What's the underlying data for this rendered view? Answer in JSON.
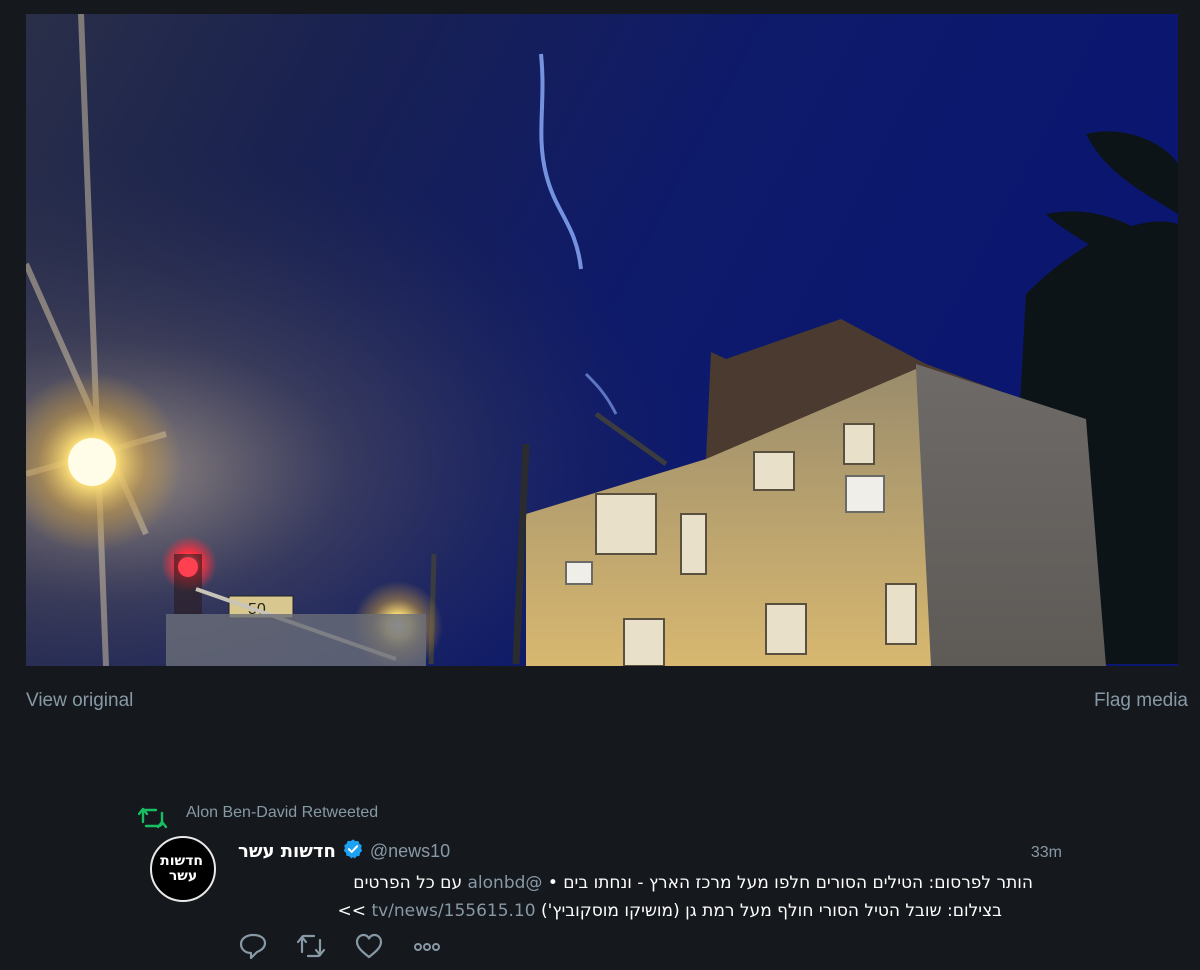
{
  "media": {
    "alt": "Night sky with missile trail over apartment building",
    "view_original_label": "View original",
    "flag_media_label": "Flag media"
  },
  "tweet": {
    "retweet_label": "Alon Ben-David Retweeted",
    "avatar_text": "חדשות עשר",
    "display_name": "חדשות עשר",
    "handle": "@news10",
    "timestamp": "33m",
    "text_line1_a": "הותר לפרסום: הטילים הסורים חלפו מעל מרכז הארץ - ונחתו בים •",
    "text_line1_mention": "@alonbd",
    "text_line1_b": "עם כל הפרטים",
    "text_line2_a": "בצילום: שובל הטיל הסורי חולף מעל רמת גן (מושיקו מוסקוביץ')",
    "text_line2_link": "tv/news/155615.10",
    "text_line2_b": ">>"
  },
  "icons": {
    "retweet": "retweet-icon",
    "verified": "verified-icon",
    "reply": "reply-icon",
    "like": "heart-icon",
    "more": "more-icon"
  },
  "colors": {
    "background": "#15181c",
    "retweet_green": "#17bf63",
    "verified_blue": "#1da1f2",
    "secondary_text": "#8899a6"
  }
}
